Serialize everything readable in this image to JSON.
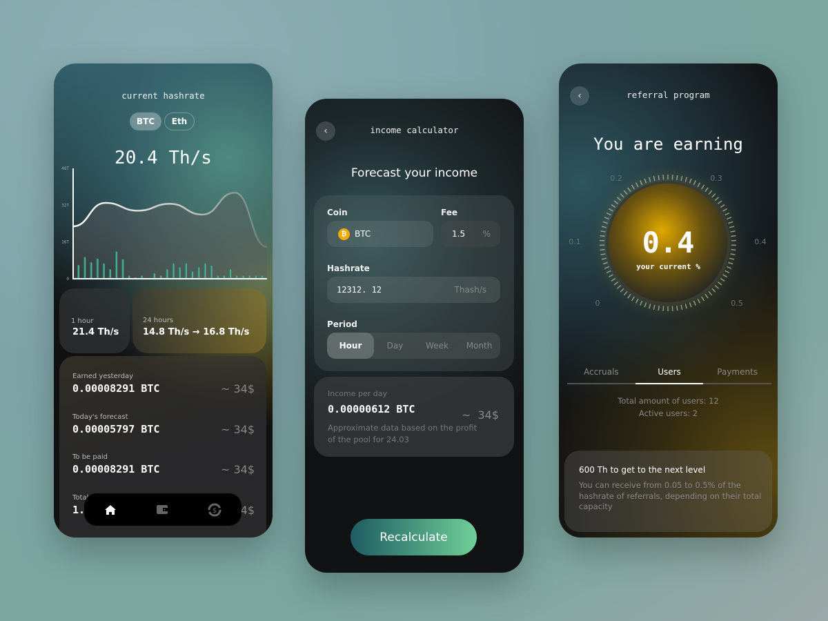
{
  "hashrate": {
    "title": "current hashrate",
    "coins": [
      "BTC",
      "Eth"
    ],
    "current": "20.4 Th/s",
    "stats": [
      {
        "label": "1 hour",
        "value": "21.4 Th/s"
      },
      {
        "label": "24 hours",
        "from": "14.8 Th/s",
        "arrow": "→",
        "to": "16.8 Th/s"
      }
    ],
    "earnings": [
      {
        "label": "Earned yesterday",
        "btc": "0.00008291 BTC",
        "usd": "~ 34$"
      },
      {
        "label": "Today's forecast",
        "btc": "0.00005797 BTC",
        "usd": "~ 34$"
      },
      {
        "label": "To be paid",
        "btc": "0.00008291 BTC",
        "usd": "~ 34$"
      },
      {
        "label": "Total",
        "btc": "1.",
        "usd": "~ 34$"
      }
    ],
    "nav": [
      "home-icon",
      "wallet-icon",
      "dollar-cycle-icon"
    ]
  },
  "chart_data": {
    "type": "bar",
    "yticks": [
      "0",
      "16T",
      "32T",
      "48T"
    ],
    "ylim": [
      0,
      48
    ],
    "bars": [
      6,
      9.5,
      7.2,
      8.8,
      6.7,
      4.2,
      11.9,
      8.5,
      1.4,
      0.6,
      1.4,
      0.2,
      2.4,
      1.4,
      4.2,
      6.7,
      5,
      6.7,
      3.2,
      5,
      6.7,
      5.7,
      1.4,
      1.4,
      4.2,
      1.4,
      1.4,
      1.4,
      1.4,
      1.4
    ],
    "line": [
      22.8,
      33,
      29.6,
      32.6,
      27.9,
      37.4,
      13.8
    ],
    "colors": {
      "bars_start": "#1f6b70",
      "bars_end": "#5fd4a0",
      "line": "#ffffff"
    }
  },
  "calculator": {
    "title": "income calculator",
    "heading": "Forecast your income",
    "coin_label": "Coin",
    "coin": "BTC",
    "fee_label": "Fee",
    "fee": "1.5",
    "fee_unit": "%",
    "hashrate_label": "Hashrate",
    "hashrate": "12312. 12",
    "hashrate_unit": "Thash/s",
    "period_label": "Period",
    "periods": [
      "Hour",
      "Day",
      "Week",
      "Month"
    ],
    "period_selected": "Hour",
    "income_label": "Income per day",
    "income": "0.00000612 BTC",
    "income_usd": "~  34$",
    "note": "Approximate data based on the profit of the pool for 24.03",
    "button": "Recalculate"
  },
  "referral": {
    "title": "referral program",
    "heading": "You are earning",
    "value": "0.4",
    "value_label": "your current %",
    "dial_ticks": [
      "0",
      "0.1",
      "0.2",
      "0.3",
      "0.4",
      "0.5"
    ],
    "tabs": [
      "Accruals",
      "Users",
      "Payments"
    ],
    "active_tab": "Users",
    "total_users": "Total amount of users: 12",
    "active_users": "Active users: 2",
    "level_title": "600 Th to get to the next level",
    "level_text": "You can receive from 0.05 to 0.5% of the hashrate of referrals, depending on their total capacity",
    "accent": "#e0a800"
  }
}
